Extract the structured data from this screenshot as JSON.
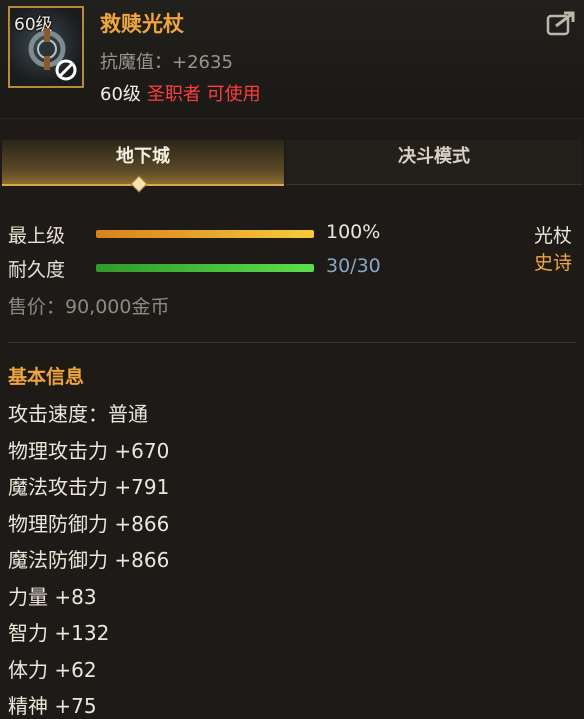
{
  "item": {
    "level_badge": "60级",
    "name": "救赎光杖",
    "magic_resist": "抗魔值：+2635",
    "req_level": "60级",
    "req_class": "圣职者 可使用"
  },
  "tabs": [
    {
      "label": "地下城",
      "active": true
    },
    {
      "label": "决斗模式",
      "active": false
    }
  ],
  "stats": {
    "grade_label": "最上级",
    "grade_value": "100%",
    "grade_fraction": 1.0,
    "durability_label": "耐久度",
    "durability_value": "30/30",
    "durability_fraction": 1.0,
    "weapon_type": "光杖",
    "rarity": "史诗",
    "price": "售价：90,000金币"
  },
  "basic_info": {
    "title": "基本信息",
    "attributes": [
      "攻击速度：普通",
      "物理攻击力 +670",
      "魔法攻击力 +791",
      "物理防御力 +866",
      "魔法防御力 +866",
      "力量 +83",
      "智力 +132",
      "体力 +62",
      "精神 +75"
    ]
  },
  "colors": {
    "name_orange": "#f0a53a",
    "class_red": "#ff3d3d",
    "durability_blue": "#8aa6c8",
    "rarity_orange": "#f0a53a"
  }
}
